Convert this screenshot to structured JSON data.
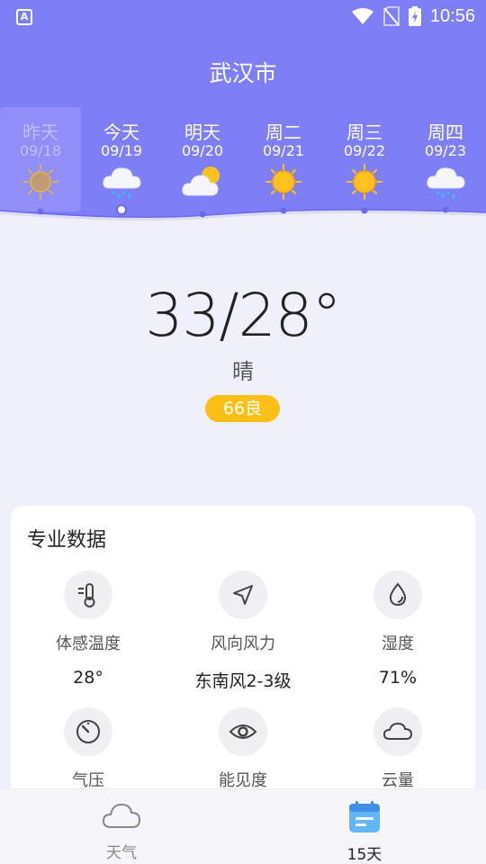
{
  "status_bar": {
    "time": "10:56",
    "app_badge": "A"
  },
  "header": {
    "city": "武汉市"
  },
  "days": [
    {
      "name": "昨天",
      "date": "09/18",
      "icon": "sun-icon"
    },
    {
      "name": "今天",
      "date": "09/19",
      "icon": "rain-cloud-icon"
    },
    {
      "name": "明天",
      "date": "09/20",
      "icon": "partly-cloudy-icon"
    },
    {
      "name": "周二",
      "date": "09/21",
      "icon": "sun-icon"
    },
    {
      "name": "周三",
      "date": "09/22",
      "icon": "sun-icon"
    },
    {
      "name": "周四",
      "date": "09/23",
      "icon": "rain-cloud-icon"
    }
  ],
  "current": {
    "temp": "33/28°",
    "condition": "晴",
    "aqi": "66良"
  },
  "pro_data": {
    "title": "专业数据",
    "items": [
      {
        "label": "体感温度",
        "value": "28°",
        "icon": "thermometer-icon"
      },
      {
        "label": "风向风力",
        "value": "东南风2-3级",
        "icon": "navigation-arrow-icon"
      },
      {
        "label": "湿度",
        "value": "71%",
        "icon": "droplet-icon"
      },
      {
        "label": "气压",
        "value": "",
        "icon": "gauge-icon"
      },
      {
        "label": "能见度",
        "value": "",
        "icon": "eye-icon"
      },
      {
        "label": "云量",
        "value": "",
        "icon": "cloud-icon"
      }
    ]
  },
  "tabs": [
    {
      "label": "天气",
      "icon": "cloud-icon",
      "active": false
    },
    {
      "label": "15天",
      "icon": "calendar-icon",
      "active": true
    }
  ],
  "colors": {
    "header": "#7e7ef6",
    "aqi": "#fbbf15",
    "sun": "#fcc11e",
    "page": "#f0f0fb"
  }
}
